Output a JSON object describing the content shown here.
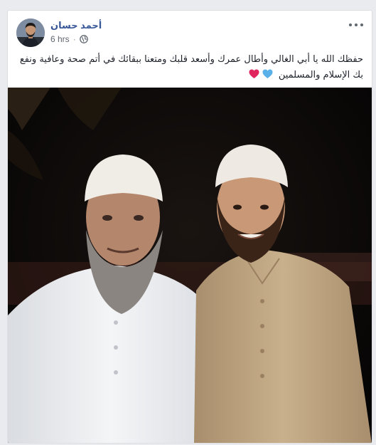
{
  "post": {
    "author": "أحمد حسان",
    "time": "6 hrs",
    "separator": "·",
    "privacy_icon": "globe-icon",
    "menu_icon": "more-options-icon",
    "text": "حفظك الله يا أبي الغالي وأطال عمرك وأسعد قلبك ومتعنا ببقائك في أتم صحة وعافية ونفع بك الإسلام والمسلمين",
    "emojis": [
      "blue-heart-emoji",
      "red-heart-emoji"
    ],
    "emoji_colors": {
      "blue": "#5ab1ea",
      "red": "#e0245e"
    },
    "link_color": "#385898"
  }
}
